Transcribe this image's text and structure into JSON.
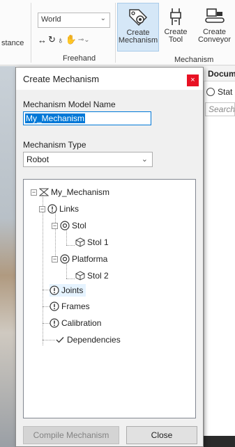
{
  "ribbon": {
    "left_fragment": "stance",
    "frame_select": "World",
    "freehand_label": "Freehand",
    "mechanism_group_label": "Mechanism",
    "buttons": [
      {
        "line1": "Create",
        "line2": "Mechanism",
        "icon": "gear-tag-icon"
      },
      {
        "line1": "Create",
        "line2": "Tool",
        "icon": "gripper-icon"
      },
      {
        "line1": "Create",
        "line2": "Conveyor",
        "icon": "conveyor-icon"
      }
    ]
  },
  "documents": {
    "tab_label": "Docum",
    "radio_label": "Stat",
    "search_placeholder": "Search"
  },
  "dialog": {
    "title": "Create Mechanism",
    "close_glyph": "×",
    "name_label": "Mechanism Model Name",
    "name_value": "My_Mechanism",
    "type_label": "Mechanism Type",
    "type_value": "Robot",
    "tree": {
      "root": "My_Mechanism",
      "links": "Links",
      "stol": "Stol",
      "stol1": "Stol 1",
      "platforma": "Platforma",
      "stol2": "Stol 2",
      "joints": "Joints",
      "frames": "Frames",
      "calibration": "Calibration",
      "dependencies": "Dependencies"
    },
    "compile_button": "Compile Mechanism",
    "close_button": "Close"
  },
  "colors": {
    "accent": "#0078d7",
    "close_red": "#e81123",
    "ribbon_active": "#d5e7f7"
  }
}
